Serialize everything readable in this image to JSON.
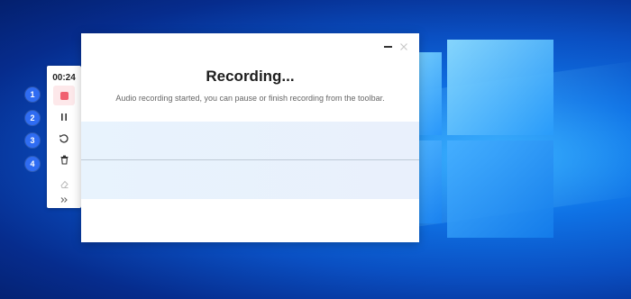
{
  "recorder": {
    "timer": "00:24",
    "title": "Recording...",
    "message": "Audio recording started, you can pause or finish recording from the toolbar."
  },
  "toolbar": {
    "tools": [
      {
        "name": "stop",
        "icon": "stop-icon"
      },
      {
        "name": "pause",
        "icon": "pause-icon"
      },
      {
        "name": "restart",
        "icon": "restart-icon"
      },
      {
        "name": "delete",
        "icon": "trash-icon"
      },
      {
        "name": "eraser",
        "icon": "eraser-icon"
      },
      {
        "name": "expand",
        "icon": "double-chevron-right-icon"
      }
    ]
  },
  "badges": [
    "1",
    "2",
    "3",
    "4"
  ],
  "colors": {
    "stop_accent": "#f06170",
    "badge_blue": "#2f6cf2",
    "wave_bg": "#e8f3fd"
  }
}
